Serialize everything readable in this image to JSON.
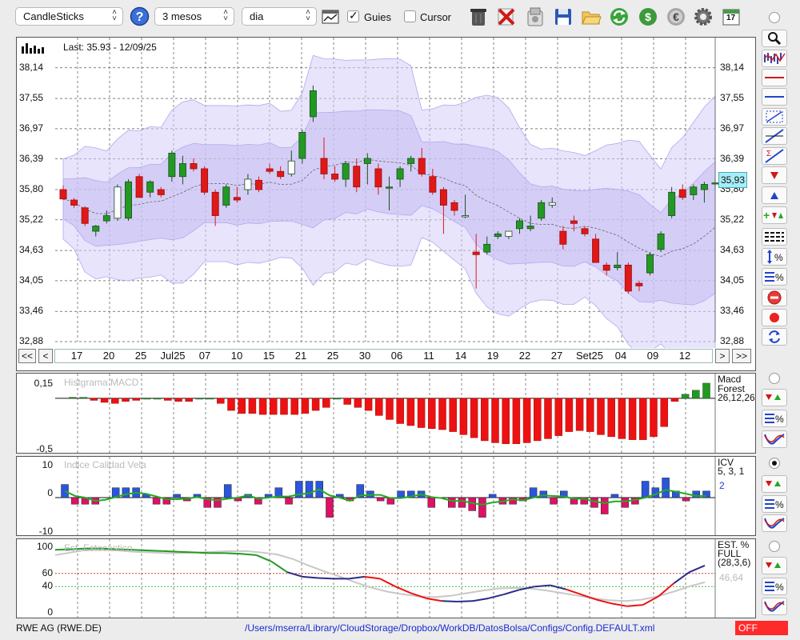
{
  "toolbar": {
    "chart_type": "CandleSticks",
    "period": "3 mesos",
    "interval": "dia",
    "guides_label": "Guies",
    "guides_checked": true,
    "cursor_label": "Cursor",
    "cursor_checked": false,
    "calendar_day": "17"
  },
  "main_chart": {
    "last_label": "Last: 35.93 - 12/09/25",
    "last_price": "35,93",
    "y_ticks": [
      "38,14",
      "37,55",
      "36,97",
      "36,39",
      "35,80",
      "35,22",
      "34,63",
      "34,05",
      "33,46",
      "32,88"
    ],
    "y_top_partial": "38,72",
    "x_ticks": [
      "17",
      "20",
      "25",
      "Jul25",
      "07",
      "10",
      "15",
      "21",
      "25",
      "30",
      "06",
      "11",
      "14",
      "19",
      "22",
      "27",
      "Set25",
      "04",
      "09",
      "12"
    ],
    "nav_first": "<<",
    "nav_prev": "<",
    "nav_next": ">",
    "nav_last": ">>"
  },
  "macd_panel": {
    "title": "Histgrama MACD",
    "legend_name": "Macd",
    "legend_name2": "Forest",
    "legend_params": "26,12,26",
    "y_top": "0,15",
    "y_bottom": "-0,5"
  },
  "icv_panel": {
    "title": "Indice Calidad Vela",
    "legend_name": "ICV",
    "legend_params": "5, 3, 1",
    "legend_value": "2",
    "y_top": "10",
    "y_mid": "0",
    "y_bottom": "-10"
  },
  "stoch_panel": {
    "title": "Est. Estocástico",
    "legend_name": "EST. %",
    "legend_name2": "FULL",
    "legend_params": "(28,3,6)",
    "legend_value": "46,64",
    "y_ticks": [
      "100",
      "60",
      "40",
      "0"
    ]
  },
  "status": {
    "symbol": "RWE AG (RWE.DE)",
    "path": "/Users/mserra/Library/CloudStorage/Dropbox/WorkDB/DatosBolsa/Configs/Config.DEFAULT.xml",
    "off_label": "OFF"
  },
  "colors": {
    "up": "#229922",
    "down": "#e01818",
    "band": "#d4cdf7",
    "band_inner": "#c5bcf4",
    "macd_bar": "#ee1111",
    "icv_pos": "#2a55dd",
    "icv_neg": "#dd1166",
    "icv_line": "#22aa22",
    "stoch_green": "#229922",
    "stoch_blue": "#2c2a88",
    "stoch_red": "#ee1111",
    "stoch_gray": "#c8c8c8"
  },
  "chart_data": [
    {
      "type": "candlestick",
      "series": [
        {
          "name": "RWE.DE",
          "ohlc": [
            [
              35.8,
              35.88,
              35.6,
              35.62
            ],
            [
              35.6,
              35.64,
              35.45,
              35.5
            ],
            [
              35.45,
              35.48,
              35.1,
              35.15
            ],
            [
              35.0,
              35.12,
              34.9,
              35.1
            ],
            [
              35.2,
              35.4,
              35.15,
              35.3
            ],
            [
              35.25,
              35.9,
              35.2,
              35.85
            ],
            [
              35.25,
              36.0,
              35.2,
              35.95
            ],
            [
              36.05,
              36.1,
              35.7,
              35.65
            ],
            [
              35.75,
              35.98,
              35.65,
              35.95
            ],
            [
              35.8,
              35.85,
              35.65,
              35.7
            ],
            [
              36.05,
              36.55,
              35.95,
              36.5
            ],
            [
              36.05,
              36.45,
              35.9,
              36.3
            ],
            [
              36.3,
              36.4,
              36.15,
              36.2
            ],
            [
              36.2,
              36.25,
              35.7,
              35.75
            ],
            [
              35.75,
              35.8,
              35.1,
              35.3
            ],
            [
              35.5,
              35.9,
              35.45,
              35.85
            ],
            [
              35.65,
              35.85,
              35.55,
              35.6
            ],
            [
              35.8,
              36.1,
              35.7,
              36.0
            ],
            [
              35.98,
              36.05,
              35.75,
              35.8
            ],
            [
              36.2,
              36.3,
              36.1,
              36.15
            ],
            [
              36.15,
              36.25,
              36.0,
              36.05
            ],
            [
              36.1,
              36.55,
              36.05,
              36.35
            ],
            [
              36.4,
              36.95,
              36.3,
              36.9
            ],
            [
              37.2,
              37.8,
              37.1,
              37.7
            ],
            [
              36.4,
              36.8,
              36.0,
              36.1
            ],
            [
              36.1,
              36.25,
              35.95,
              36.0
            ],
            [
              36.0,
              36.35,
              35.85,
              36.3
            ],
            [
              36.25,
              36.4,
              35.75,
              35.85
            ],
            [
              36.3,
              36.5,
              35.9,
              36.4
            ],
            [
              36.2,
              36.3,
              35.7,
              35.85
            ],
            [
              35.85,
              36.05,
              35.4,
              35.85
            ],
            [
              36.0,
              36.25,
              35.85,
              36.2
            ],
            [
              36.3,
              36.45,
              36.15,
              36.4
            ],
            [
              36.4,
              36.6,
              36.05,
              36.1
            ],
            [
              36.05,
              36.2,
              35.7,
              35.75
            ],
            [
              35.8,
              35.85,
              34.95,
              35.5
            ],
            [
              35.55,
              35.6,
              35.3,
              35.4
            ],
            [
              35.3,
              35.7,
              35.25,
              35.3
            ],
            [
              34.6,
              34.95,
              33.9,
              34.55
            ],
            [
              34.6,
              34.9,
              34.55,
              34.75
            ],
            [
              34.9,
              35.0,
              34.85,
              34.95
            ],
            [
              34.9,
              35.0,
              34.85,
              35.0
            ],
            [
              35.05,
              35.25,
              34.95,
              35.2
            ],
            [
              35.05,
              35.3,
              35.0,
              35.1
            ],
            [
              35.25,
              35.6,
              35.2,
              35.55
            ],
            [
              35.5,
              35.65,
              35.45,
              35.55
            ],
            [
              35.0,
              35.1,
              34.65,
              34.75
            ],
            [
              35.2,
              35.3,
              35.0,
              35.15
            ],
            [
              35.05,
              35.1,
              34.9,
              34.95
            ],
            [
              34.85,
              34.95,
              34.4,
              34.4
            ],
            [
              34.35,
              34.4,
              34.15,
              34.25
            ],
            [
              34.3,
              34.6,
              34.25,
              34.35
            ],
            [
              34.35,
              34.4,
              33.8,
              33.85
            ],
            [
              34.0,
              34.05,
              33.85,
              33.95
            ],
            [
              34.2,
              34.6,
              34.15,
              34.55
            ],
            [
              34.65,
              35.0,
              34.6,
              34.95
            ],
            [
              35.3,
              35.85,
              35.25,
              35.75
            ],
            [
              35.8,
              35.9,
              35.6,
              35.65
            ],
            [
              35.7,
              35.9,
              35.6,
              35.85
            ],
            [
              35.8,
              35.95,
              35.55,
              35.9
            ],
            [
              35.92,
              36.0,
              35.85,
              35.93
            ]
          ]
        }
      ],
      "ylim": [
        32.88,
        38.72
      ]
    },
    {
      "type": "bar",
      "name": "MACD histogram",
      "values": [
        0.01,
        0.01,
        -0.02,
        -0.04,
        -0.05,
        -0.03,
        -0.02,
        0,
        0,
        -0.02,
        -0.03,
        -0.03,
        0,
        0,
        -0.05,
        -0.12,
        -0.15,
        -0.15,
        -0.16,
        -0.16,
        -0.16,
        -0.16,
        -0.15,
        -0.12,
        -0.09,
        0,
        -0.06,
        -0.09,
        -0.12,
        -0.17,
        -0.21,
        -0.25,
        -0.27,
        -0.29,
        -0.3,
        -0.31,
        -0.33,
        -0.36,
        -0.39,
        -0.42,
        -0.44,
        -0.45,
        -0.45,
        -0.44,
        -0.42,
        -0.4,
        -0.37,
        -0.33,
        -0.32,
        -0.33,
        -0.36,
        -0.38,
        -0.4,
        -0.41,
        -0.41,
        -0.38,
        -0.28,
        -0.03,
        0.04,
        0.08,
        0.15
      ],
      "ylim": [
        -0.5,
        0.15
      ]
    },
    {
      "type": "bar",
      "name": "ICV",
      "values": [
        4,
        -2,
        -2,
        -2,
        0,
        3,
        3,
        3,
        1,
        -2,
        -2,
        1,
        -1,
        1,
        -3,
        -3,
        4,
        -1,
        1,
        -2,
        1,
        3,
        -2,
        5,
        5,
        5,
        -6,
        1,
        -1,
        4,
        2,
        -1,
        -2,
        2,
        2,
        2,
        -3,
        0,
        -3,
        -3,
        -4,
        -6,
        1,
        -2,
        -2,
        -1,
        3,
        2,
        -2,
        2,
        -2,
        -2,
        -3,
        -5,
        1,
        -3,
        -2,
        5,
        3,
        6,
        2,
        -1,
        2,
        2
      ],
      "ylim": [
        -10,
        10
      ]
    },
    {
      "type": "line",
      "name": "Stochastic %K",
      "y": [
        96,
        97,
        98,
        98,
        97,
        96,
        95,
        94,
        93,
        92,
        91,
        91,
        90,
        88,
        78,
        62,
        55,
        53,
        52,
        52,
        55,
        52,
        40,
        30,
        22,
        18,
        17,
        18,
        22,
        28,
        35,
        40,
        42,
        36,
        28,
        20,
        14,
        10,
        12,
        25,
        45,
        62,
        72
      ],
      "ylim": [
        0,
        100
      ]
    },
    {
      "type": "line",
      "name": "Stochastic %D",
      "y": [
        88,
        92,
        96,
        96,
        95,
        93,
        92,
        91,
        91,
        92,
        93,
        94,
        94,
        92,
        89,
        82,
        72,
        63,
        55,
        46,
        38,
        32,
        28,
        25,
        24,
        26,
        30,
        34,
        37,
        38,
        37,
        34,
        30,
        26,
        22,
        19,
        18,
        20,
        25,
        32,
        40,
        46.64
      ],
      "ylim": [
        0,
        100
      ]
    }
  ]
}
